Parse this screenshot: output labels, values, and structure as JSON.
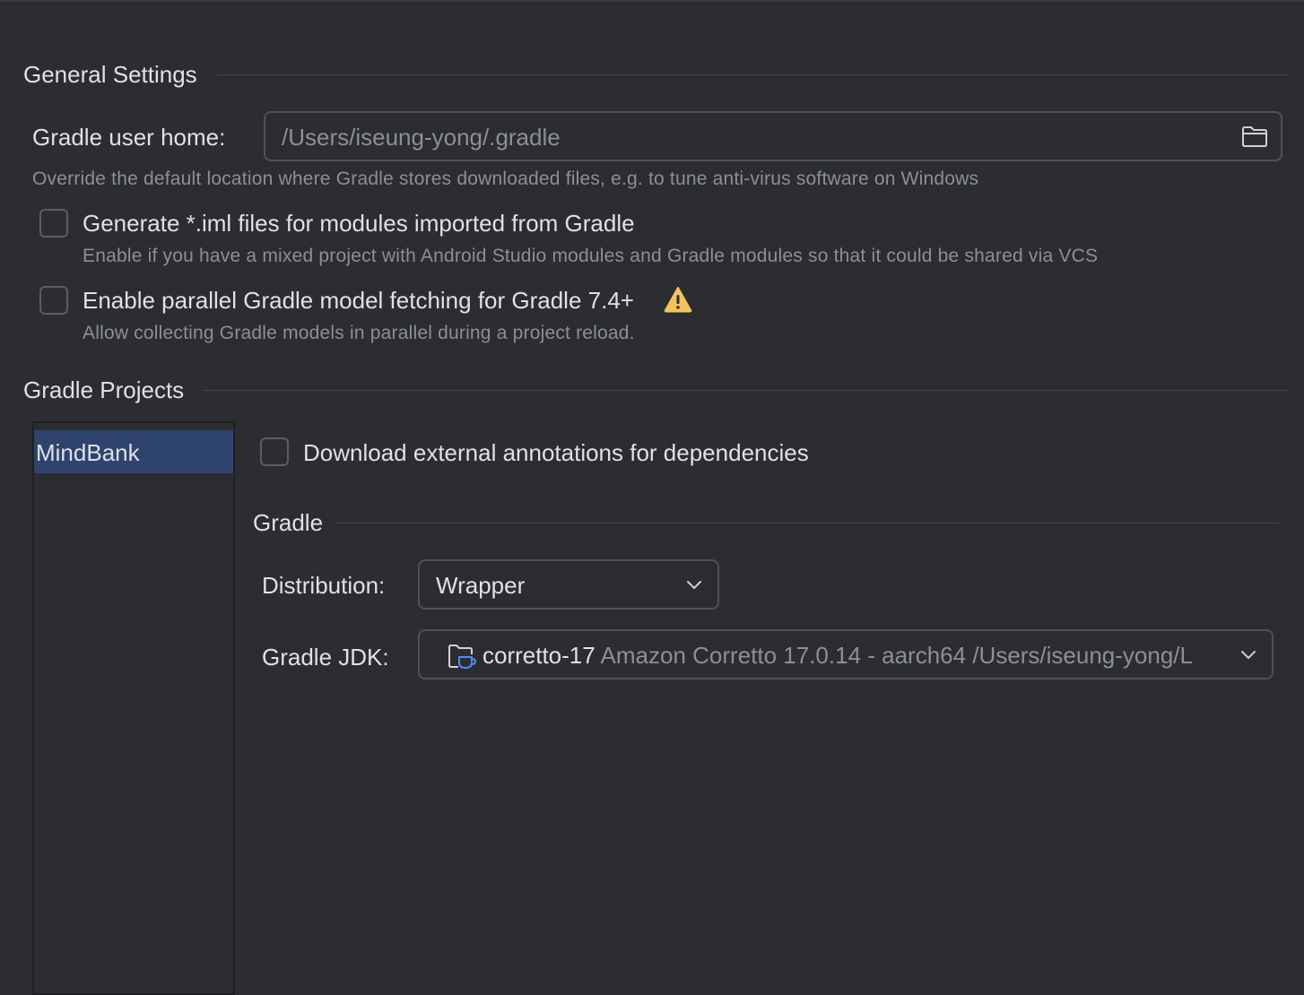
{
  "general": {
    "title": "General Settings",
    "gradle_user_home_label": "Gradle user home:",
    "gradle_user_home_value": "/Users/iseung-yong/.gradle",
    "gradle_user_home_hint": "Override the default location where Gradle stores downloaded files, e.g. to tune anti-virus software on Windows",
    "generate_iml": {
      "label": "Generate *.iml files for modules imported from Gradle",
      "hint": "Enable if you have a mixed project with Android Studio modules and Gradle modules so that it could be shared via VCS",
      "checked": false
    },
    "parallel_fetch": {
      "label": "Enable parallel Gradle model fetching for Gradle 7.4+",
      "hint": "Allow collecting Gradle models in parallel during a project reload.",
      "checked": false
    }
  },
  "projects": {
    "title": "Gradle Projects",
    "list": [
      {
        "name": "MindBank",
        "selected": true
      }
    ],
    "download_annotations": {
      "label": "Download external annotations for dependencies",
      "checked": false
    },
    "gradle_group_title": "Gradle",
    "distribution_label": "Distribution:",
    "distribution_value": "Wrapper",
    "jdk_label": "Gradle JDK:",
    "jdk_name": "corretto-17",
    "jdk_detail": "Amazon Corretto 17.0.14 - aarch64 /Users/iseung-yong/L"
  },
  "colors": {
    "background": "#2b2d30",
    "selection": "#2e436e",
    "warning": "#f2c55c",
    "jdk_icon_accent": "#548af7"
  }
}
